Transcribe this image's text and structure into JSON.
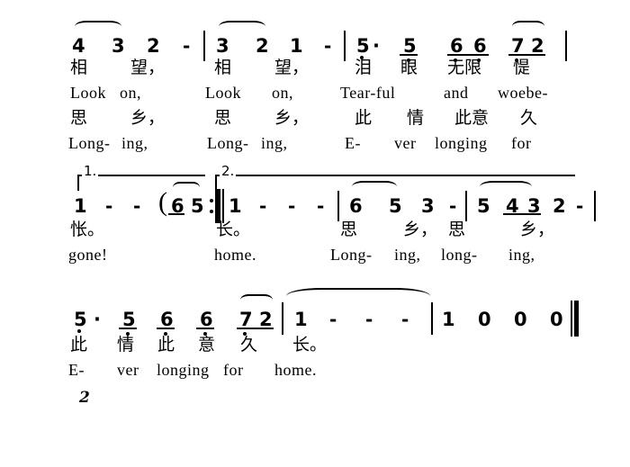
{
  "document": {
    "type": "jianpu-numbered-musical-notation",
    "page_number": "2"
  },
  "systems": [
    {
      "id": "system-1",
      "measures": [
        {
          "id": "m1",
          "notes": [
            "4",
            "3",
            "2",
            "-"
          ]
        },
        {
          "id": "m2",
          "notes": [
            "3",
            "2",
            "1",
            "-"
          ]
        },
        {
          "id": "m3",
          "notes": [
            "5",
            "·",
            "5",
            "6",
            "6",
            "7",
            "2"
          ]
        }
      ],
      "lyric_lines": [
        {
          "id": "v1-cn",
          "lang": "zh",
          "syllables": [
            "相",
            "望，",
            "相",
            "望，",
            "泪",
            "眼",
            "无限",
            "惿"
          ]
        },
        {
          "id": "v1-en",
          "lang": "en",
          "syllables": [
            "Look",
            "on,",
            "Look",
            "on,",
            "Tear-ful",
            "and",
            "woebe-"
          ]
        },
        {
          "id": "v2-cn",
          "lang": "zh",
          "syllables": [
            "思",
            "乡，",
            "思",
            "乡，",
            "此",
            "情",
            "此意",
            "久"
          ]
        },
        {
          "id": "v2-en",
          "lang": "en",
          "syllables": [
            "Long-",
            "ing,",
            "Long-",
            "ing,",
            "E-",
            "ver",
            "longing",
            "for"
          ]
        }
      ]
    },
    {
      "id": "system-2",
      "volta1_label": "1.",
      "volta2_label": "2.",
      "measures": [
        {
          "id": "m4",
          "notes": [
            "1",
            "-",
            "-",
            "(",
            "6",
            "5"
          ]
        },
        {
          "id": "m5",
          "notes": [
            "1",
            "-",
            "-",
            "-"
          ]
        },
        {
          "id": "m6",
          "notes": [
            "6",
            "5",
            "3",
            "-"
          ]
        },
        {
          "id": "m7",
          "notes": [
            "5",
            "4",
            "3",
            "2",
            "-"
          ]
        }
      ],
      "lyric_lines": [
        {
          "id": "v1-cn",
          "lang": "zh",
          "syllables": [
            "怅。",
            "长。",
            "思",
            "乡，",
            "思",
            "乡，"
          ]
        },
        {
          "id": "v1-en",
          "lang": "en",
          "syllables": [
            "gone!",
            "home.",
            "Long-",
            "ing,",
            "long-",
            "ing,"
          ]
        }
      ]
    },
    {
      "id": "system-3",
      "measures": [
        {
          "id": "m8",
          "notes": [
            "5",
            "·",
            "5",
            "6",
            "6",
            "7",
            "2"
          ]
        },
        {
          "id": "m9",
          "notes": [
            "1",
            "-",
            "-",
            "-"
          ]
        },
        {
          "id": "m10",
          "notes": [
            "1",
            "0",
            "0",
            "0"
          ]
        }
      ],
      "lyric_lines": [
        {
          "id": "v1-cn",
          "lang": "zh",
          "syllables": [
            "此",
            "情",
            "此",
            "意",
            "久",
            "长。"
          ]
        },
        {
          "id": "v1-en",
          "lang": "en",
          "syllables": [
            "E-",
            "ver",
            "longing",
            "for",
            "home."
          ]
        }
      ]
    }
  ],
  "n": {
    "n1": "1",
    "n2": "2",
    "n3": "3",
    "n4": "4",
    "n5": "5",
    "n6": "6",
    "n7": "7",
    "n0": "0",
    "dash": "-",
    "dot": "·",
    "lparen": "(",
    "rparen": ")"
  },
  "s1": {
    "m1": {
      "a": "4",
      "b": "3",
      "c": "2",
      "d": "-"
    },
    "m2": {
      "a": "3",
      "b": "2",
      "c": "1",
      "d": "-"
    },
    "m3": {
      "a": "5",
      "adot": "·",
      "b": "5",
      "c": "6",
      "d": "6",
      "e": "7",
      "f": "2"
    },
    "cn1": {
      "a": "相",
      "b": "望，",
      "c": "相",
      "d": "望，",
      "e": "泪",
      "f": "眼",
      "g": "无限",
      "h": "惿"
    },
    "en1": {
      "a": "Look",
      "b": "on,",
      "c": "Look",
      "d": "on,",
      "e": "Tear-ful",
      "f": "and",
      "g": "woebe-"
    },
    "cn2": {
      "a": "思",
      "b": "乡，",
      "c": "思",
      "d": "乡，",
      "e": "此",
      "f": "情",
      "g": "此意",
      "h": "久"
    },
    "en2": {
      "a": "Long-",
      "b": "ing,",
      "c": "Long-",
      "d": "ing,",
      "e": "E-",
      "f": "ver",
      "g": "longing",
      "h": "for"
    }
  },
  "s2": {
    "volta1": "1.",
    "volta2": "2.",
    "m4": {
      "a": "1",
      "b": "-",
      "c": "-",
      "lp": "(",
      "d": "6",
      "e": "5"
    },
    "m5": {
      "a": "1",
      "b": "-",
      "c": "-",
      "d": "-"
    },
    "m6": {
      "a": "6",
      "b": "5",
      "c": "3",
      "d": "-"
    },
    "m7": {
      "a": "5",
      "b": "4",
      "c": "3",
      "d": "2",
      "e": "-"
    },
    "cn1": {
      "a": "怅。",
      "b": "长。",
      "c": "思",
      "d": "乡，",
      "e": "思",
      "f": "乡，"
    },
    "en1": {
      "a": "gone!",
      "b": "home.",
      "c": "Long-",
      "d": "ing,",
      "e": "long-",
      "f": "ing,"
    }
  },
  "s3": {
    "m8": {
      "a": "5",
      "adot": "·",
      "b": "5",
      "c": "6",
      "d": "6",
      "e": "7",
      "f": "2"
    },
    "m9": {
      "a": "1",
      "b": "-",
      "c": "-",
      "d": "-"
    },
    "m10": {
      "a": "1",
      "b": "0",
      "c": "0",
      "d": "0"
    },
    "cn1": {
      "a": "此",
      "b": "情",
      "c": "此",
      "d": "意",
      "e": "久",
      "f": "长。"
    },
    "en1": {
      "a": "E-",
      "b": "ver",
      "c": "longing",
      "d": "for",
      "e": "home."
    }
  },
  "footer": {
    "page": "2"
  }
}
